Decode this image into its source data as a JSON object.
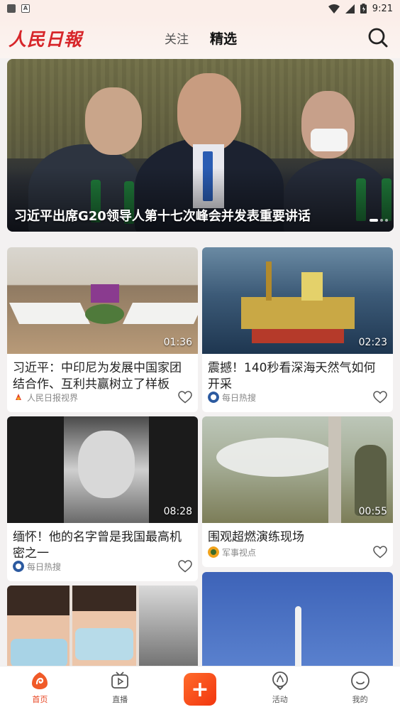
{
  "status_bar": {
    "time": "9:21",
    "notif_letter": "A"
  },
  "header": {
    "logo": "人民日報",
    "tabs": [
      {
        "label": "关注"
      },
      {
        "label": "精选"
      }
    ]
  },
  "hero": {
    "title": "习近平出席G20领导人第十七次峰会并发表重要讲话"
  },
  "cards": [
    {
      "title": "习近平：中印尼为发展中国家团结合作、互利共赢树立了样板",
      "duration": "01:36",
      "source": "人民日报视界"
    },
    {
      "title": "震撼！140秒看深海天然气如何开采",
      "duration": "02:23",
      "source": "每日热搜"
    },
    {
      "title": "缅怀！他的名字曾是我国最高机密之一",
      "duration": "08:28",
      "source": "每日热搜"
    },
    {
      "title": "围观超燃演练现场",
      "duration": "00:55",
      "source": "军事视点"
    }
  ],
  "bottom_nav": [
    {
      "label": "首页"
    },
    {
      "label": "直播"
    },
    {
      "label": ""
    },
    {
      "label": "活动"
    },
    {
      "label": "我的"
    }
  ],
  "colors": {
    "accent": "#e8431f",
    "brand_red": "#d7262a",
    "background": "#f3f1f1"
  }
}
